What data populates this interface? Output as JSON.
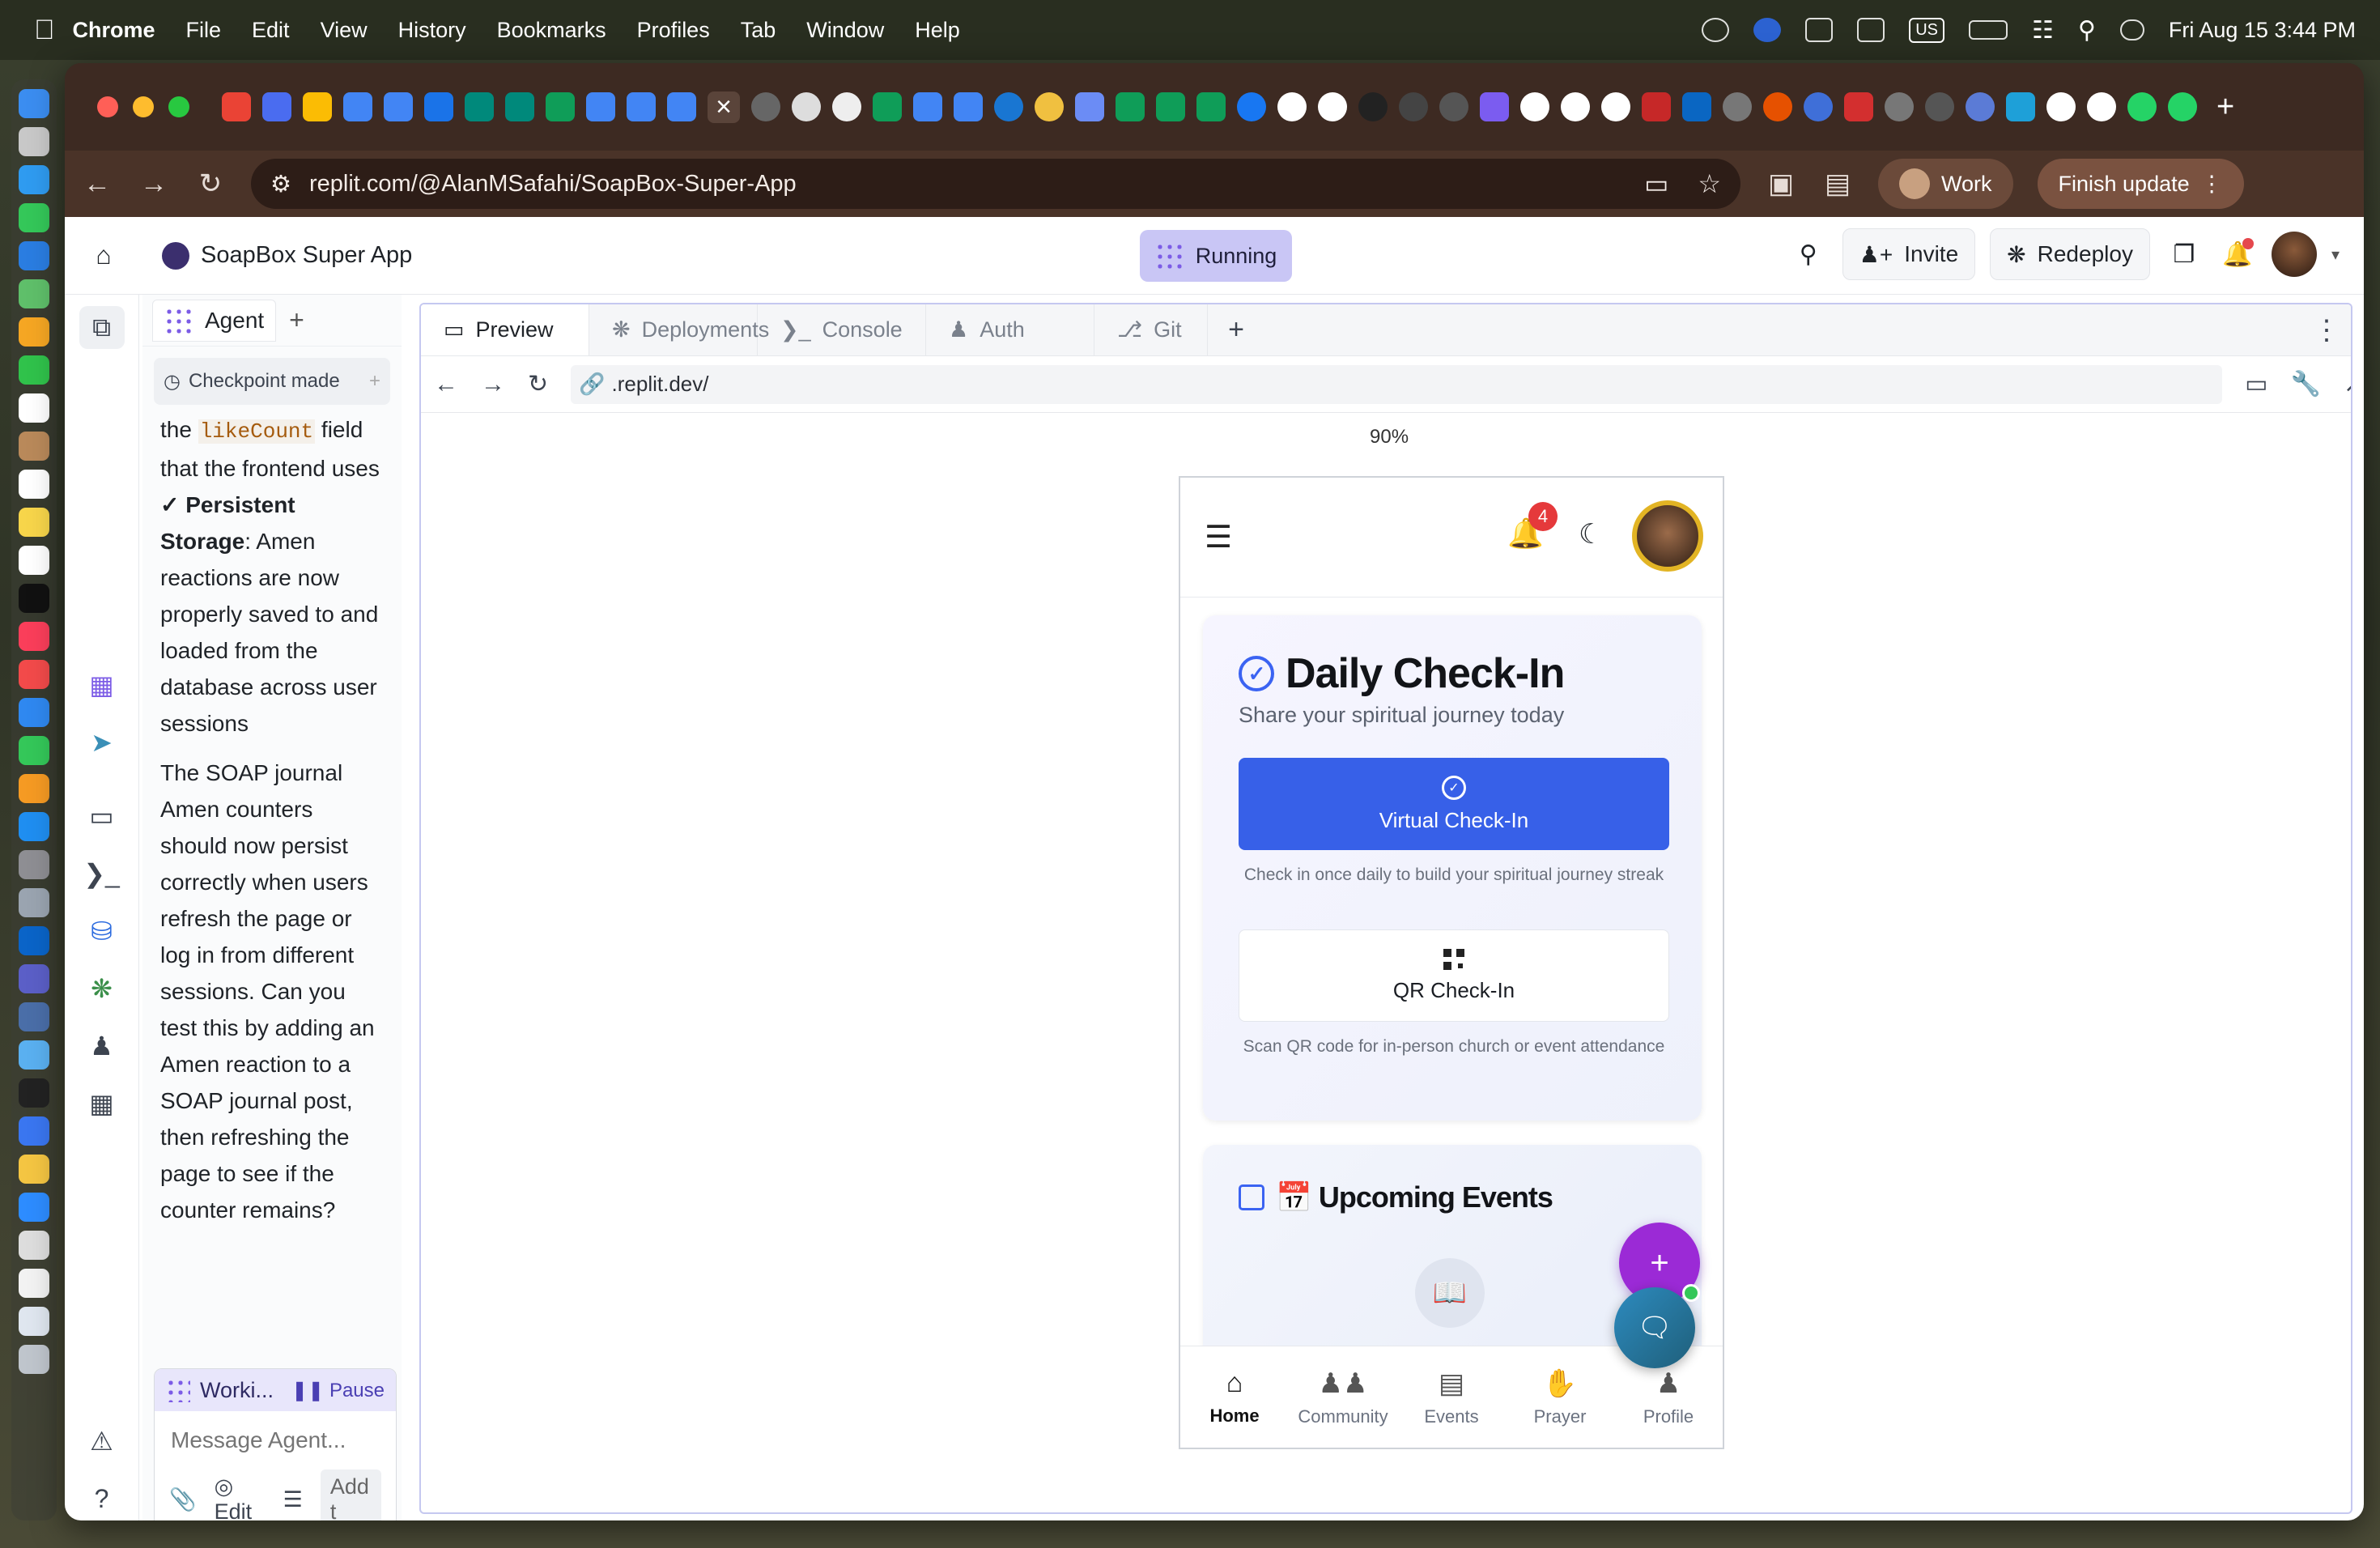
{
  "menubar": {
    "app": "Chrome",
    "items": [
      "File",
      "Edit",
      "View",
      "History",
      "Bookmarks",
      "Profiles",
      "Tab",
      "Window",
      "Help"
    ],
    "lang": "US",
    "clock": "Fri Aug 15  3:44 PM"
  },
  "browser": {
    "url": "replit.com/@AlanMSafahi/SoapBox-Super-App",
    "profile_label": "Work",
    "finish_update_label": "Finish update"
  },
  "replit": {
    "project_name": "SoapBox Super App",
    "status_label": "Running",
    "invite_label": "Invite",
    "redeploy_label": "Redeploy"
  },
  "agent": {
    "tab_label": "Agent",
    "checkpoint_label": "Checkpoint made",
    "message": {
      "line1_pre": "the ",
      "line1_code": "likeCount",
      "line1_post": " field that the frontend uses",
      "persist_title": "✓ Persistent Storage",
      "persist_text": ": Amen reactions are now properly saved to and loaded from the database across user sessions",
      "para2": "The SOAP journal Amen counters should now persist correctly when users refresh the page or log in from different sessions. Can you test this by adding an Amen reaction to a SOAP journal post, then refreshing the page to see if the counter remains?"
    },
    "working_label": "Worki...",
    "pause_label": "Pause",
    "input_placeholder": "Message Agent...",
    "edit_label": "Edit",
    "add_label": "Add t"
  },
  "workspace": {
    "tabs": [
      "Preview",
      "Deployments",
      "Console",
      "Auth",
      "Git"
    ],
    "preview_url": ".replit.dev/",
    "zoom": "90%"
  },
  "app": {
    "notification_count": "4",
    "checkin_title": "Daily Check-In",
    "checkin_subtitle": "Share your spiritual journey today",
    "virtual_label": "Virtual Check-In",
    "virtual_hint": "Check in once daily to build your spiritual journey streak",
    "qr_label": "QR Check-In",
    "qr_hint": "Scan QR code for in-person church or event attendance",
    "events_title": "📅 Upcoming Events",
    "nav": [
      "Home",
      "Community",
      "Events",
      "Prayer",
      "Profile"
    ]
  },
  "colors": {
    "accent": "#3760e8",
    "fab_purple": "#9b2ad6",
    "running_bg": "#c9c6f5"
  }
}
